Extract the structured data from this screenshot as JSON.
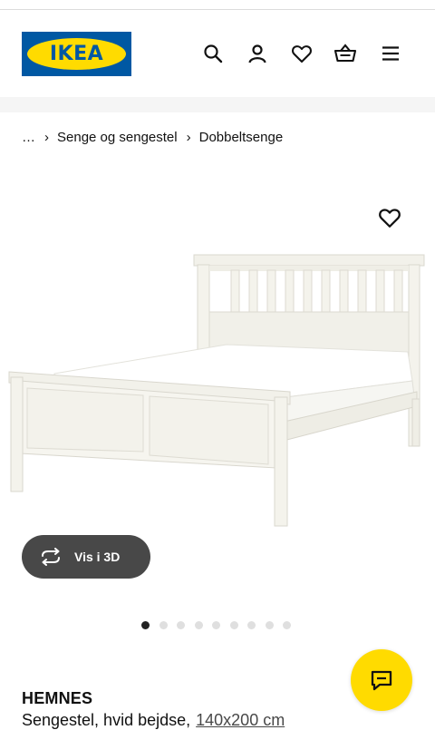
{
  "header": {
    "logo_text": "IKEA",
    "icons": [
      "search-icon",
      "user-icon",
      "heart-icon",
      "basket-icon",
      "menu-icon"
    ]
  },
  "breadcrumb": {
    "ellipsis": "…",
    "items": [
      "Senge og sengestel",
      "Dobbeltsenge"
    ]
  },
  "gallery": {
    "view_3d_label": "Vis i 3D",
    "dot_count": 9,
    "active_index": 0
  },
  "product": {
    "name": "HEMNES",
    "description": "Sengestel, hvid bejdse,",
    "size": "140x200 cm"
  },
  "colors": {
    "brand_blue": "#0058a3",
    "brand_yellow": "#ffdb00",
    "button_dark": "#484848"
  }
}
